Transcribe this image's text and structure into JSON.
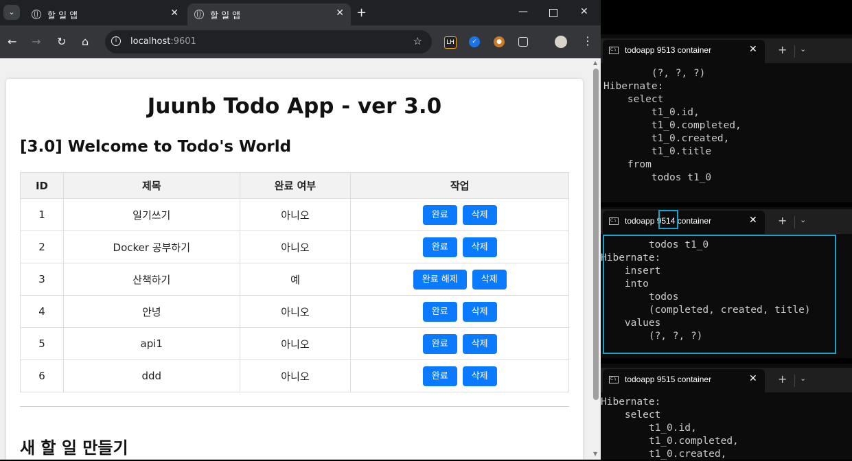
{
  "browser": {
    "tabs": [
      {
        "title": "할 일 앱",
        "active": false
      },
      {
        "title": "할 일 앱",
        "active": true
      }
    ],
    "url_host": "localhost",
    "url_port": ":9601"
  },
  "page": {
    "title": "Juunb Todo App - ver 3.0",
    "subtitle": "[3.0] Welcome to Todo's World",
    "table": {
      "headers": [
        "ID",
        "제목",
        "완료 여부",
        "작업"
      ],
      "rows": [
        {
          "id": "1",
          "title": "일기쓰기",
          "done": "아니오",
          "toggle": "완료",
          "delete": "삭제"
        },
        {
          "id": "2",
          "title": "Docker 공부하기",
          "done": "아니오",
          "toggle": "완료",
          "delete": "삭제"
        },
        {
          "id": "3",
          "title": "산책하기",
          "done": "예",
          "toggle": "완료 해제",
          "delete": "삭제"
        },
        {
          "id": "4",
          "title": "안녕",
          "done": "아니오",
          "toggle": "완료",
          "delete": "삭제"
        },
        {
          "id": "5",
          "title": "api1",
          "done": "아니오",
          "toggle": "완료",
          "delete": "삭제"
        },
        {
          "id": "6",
          "title": "ddd",
          "done": "아니오",
          "toggle": "완료",
          "delete": "삭제"
        }
      ]
    },
    "new_heading": "새 할 일 만들기"
  },
  "terminals": [
    {
      "title": "todoapp 9513 container",
      "lines": [
        "        (?, ?, ?)",
        "Hibernate:",
        "    select",
        "        t1_0.id,",
        "        t1_0.completed,",
        "        t1_0.created,",
        "        t1_0.title",
        "    from",
        "        todos t1_0"
      ]
    },
    {
      "title": "todoapp 9514 container",
      "lines": [
        "        todos t1_0",
        "Hibernate:",
        "    insert",
        "    into",
        "        todos",
        "        (completed, created, title)",
        "    values",
        "        (?, ?, ?)"
      ]
    },
    {
      "title": "todoapp 9515 container",
      "lines": [
        "Hibernate:",
        "    select",
        "        t1_0.id,",
        "        t1_0.completed,",
        "        t1_0.created,"
      ]
    }
  ],
  "icons": {
    "tab_favicon": "globe-icon",
    "close": "close-icon",
    "terminal": "cmd-icon"
  },
  "colors": {
    "primary_button": "#0a7bff",
    "highlight_box": "#1aa3c8"
  }
}
